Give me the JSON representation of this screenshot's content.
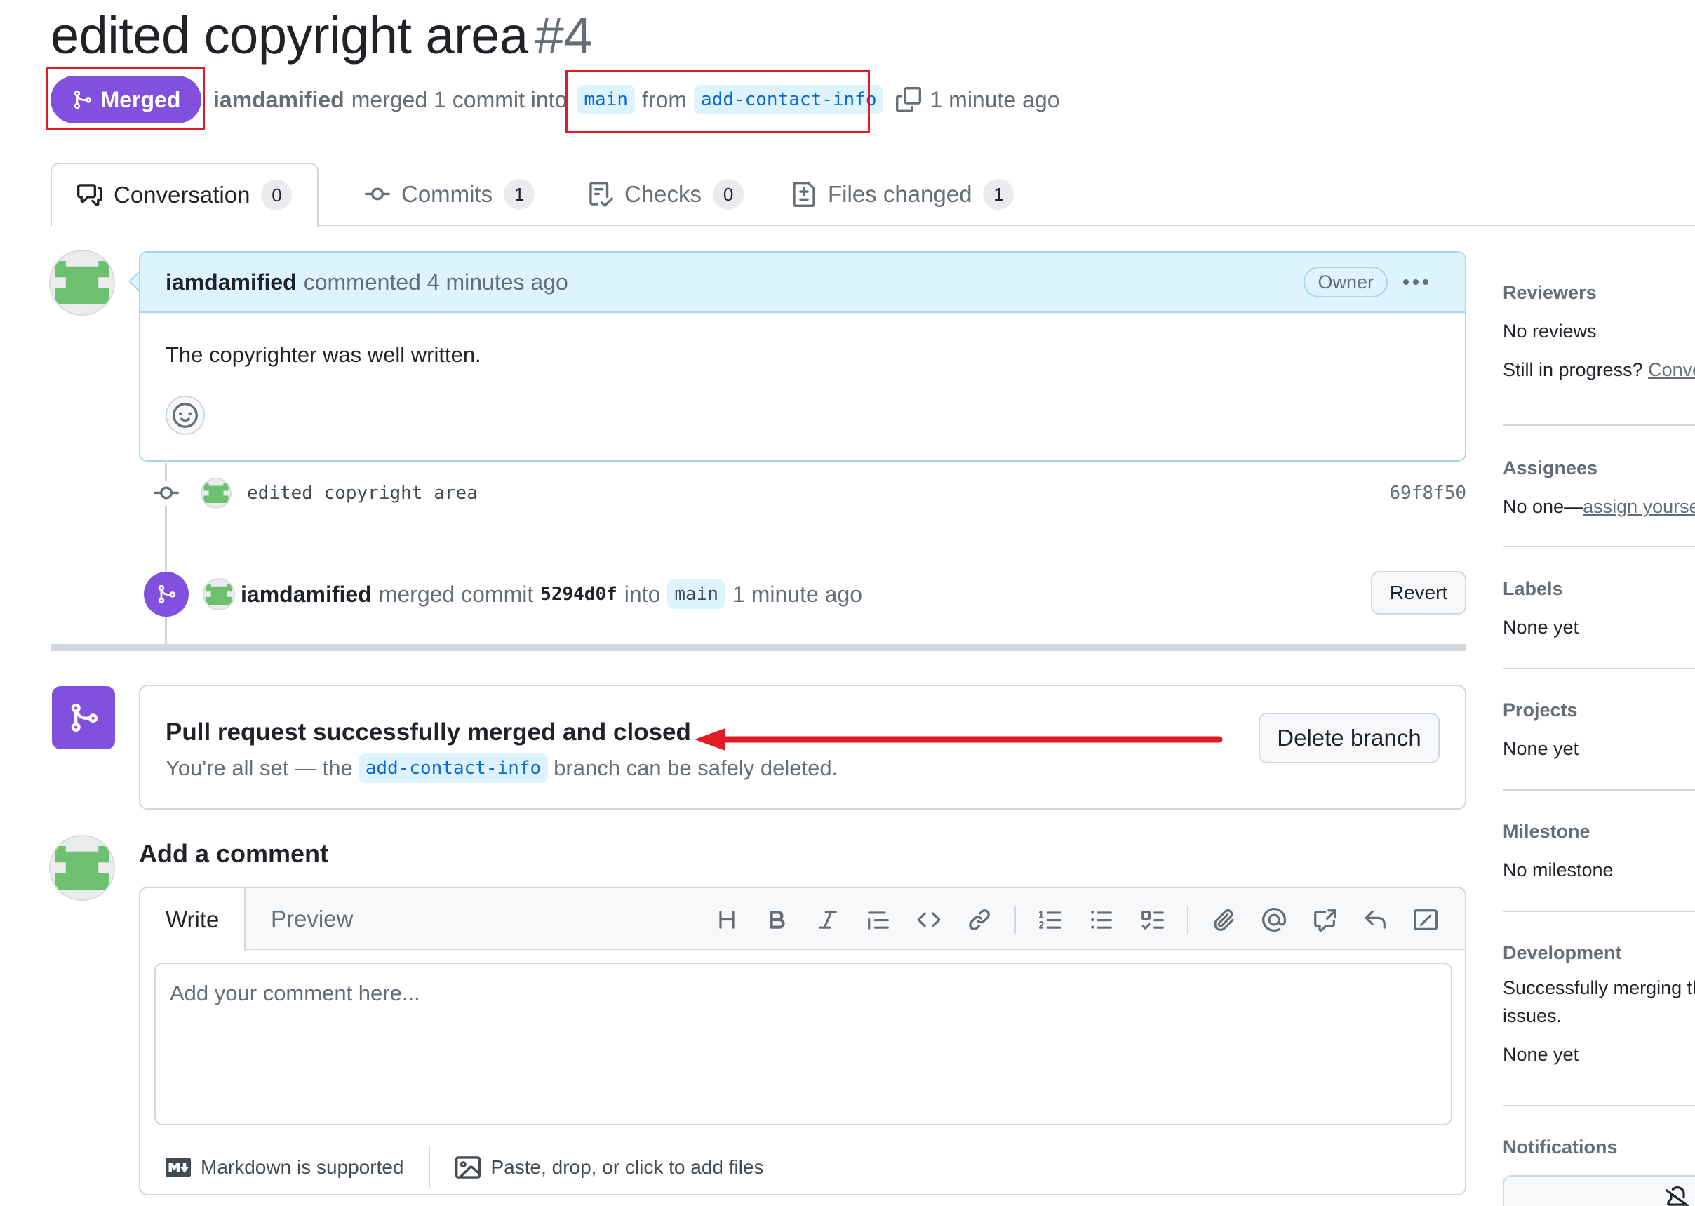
{
  "pr": {
    "title": "edited copyright area",
    "number": "#4",
    "state": "Merged",
    "author": "iamdamified",
    "merged_text": "merged 1 commit into",
    "base_branch": "main",
    "from_text": "from",
    "head_branch": "add-contact-info",
    "time": "1 minute ago"
  },
  "tabs": [
    {
      "label": "Conversation",
      "count": "0"
    },
    {
      "label": "Commits",
      "count": "1"
    },
    {
      "label": "Checks",
      "count": "0"
    },
    {
      "label": "Files changed",
      "count": "1"
    }
  ],
  "comment": {
    "author": "iamdamified",
    "action": "commented 4 minutes ago",
    "badge": "Owner",
    "body": "The copyrighter was well written."
  },
  "commit": {
    "message": "edited copyright area",
    "sha": "69f8f50"
  },
  "merge_event": {
    "author": "iamdamified",
    "text1": "merged commit",
    "sha": "5294d0f",
    "text2": "into",
    "branch": "main",
    "time": "1 minute ago",
    "revert_label": "Revert"
  },
  "merge_status": {
    "title": "Pull request successfully merged and closed",
    "sub_before": "You're all set — the",
    "branch": "add-contact-info",
    "sub_after": "branch can be safely deleted.",
    "delete_label": "Delete branch"
  },
  "add_comment": {
    "title": "Add a comment",
    "tab_write": "Write",
    "tab_preview": "Preview",
    "placeholder": "Add your comment here...",
    "markdown_note": "Markdown is supported",
    "attach_note": "Paste, drop, or click to add files"
  },
  "sidebar": {
    "reviewers": {
      "title": "Reviewers",
      "value": "No reviews",
      "extra": "Still in progress?",
      "extra_link": "Conve"
    },
    "assignees": {
      "title": "Assignees",
      "value": "No one—",
      "link": "assign yourse"
    },
    "labels": {
      "title": "Labels",
      "value": "None yet"
    },
    "projects": {
      "title": "Projects",
      "value": "None yet"
    },
    "milestone": {
      "title": "Milestone",
      "value": "No milestone"
    },
    "development": {
      "title": "Development",
      "value_line1": "Successfully merging th",
      "value_line2": "issues.",
      "value2": "None yet"
    },
    "notifications": {
      "title": "Notifications"
    }
  },
  "colors": {
    "merged_purple": "#8250df",
    "annotation_red": "#e01b24",
    "link_blue": "#0969da",
    "highlight_blue": "#ddf4ff",
    "avatar_green": "#6cc070"
  },
  "icons": [
    "git-merge-icon",
    "copy-icon",
    "comment-discussion-icon",
    "git-commit-icon",
    "checklist-icon",
    "file-diff-icon",
    "kebab-horizontal-icon",
    "smiley-icon",
    "heading-icon",
    "bold-icon",
    "italic-icon",
    "quote-icon",
    "code-icon",
    "link-icon",
    "ordered-list-icon",
    "unordered-list-icon",
    "tasklist-icon",
    "paperclip-icon",
    "mention-icon",
    "cross-reference-icon",
    "reply-icon",
    "slash-command-icon",
    "markdown-icon",
    "image-icon",
    "bell-slash-icon"
  ]
}
